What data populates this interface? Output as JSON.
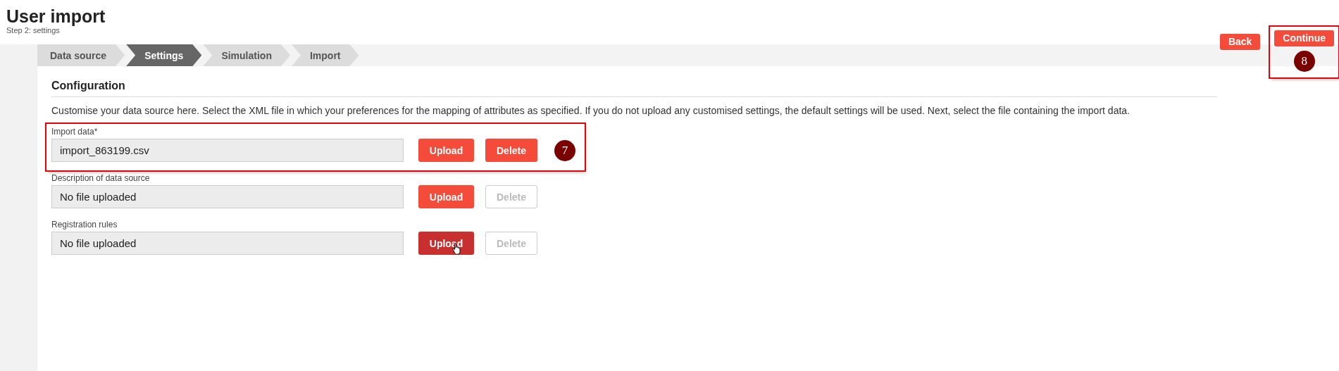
{
  "header": {
    "title": "User import",
    "subtitle": "Step 2: settings"
  },
  "steps": [
    {
      "label": "Data source",
      "selected": false
    },
    {
      "label": "Settings",
      "selected": true
    },
    {
      "label": "Simulation",
      "selected": false
    },
    {
      "label": "Import",
      "selected": false
    }
  ],
  "nav_buttons": [
    {
      "label": "Back"
    },
    {
      "label": "Continue",
      "callout": "8"
    }
  ],
  "section": {
    "title": "Configuration",
    "description": "Customise your data source here. Select the XML file in which your preferences for the mapping of attributes as specified. If you do not upload any customised settings, the default settings will be used. Next, select the file containing the import data."
  },
  "fields": [
    {
      "label": "Import data*",
      "value": "import_863199.csv",
      "callout": "7",
      "upload": {
        "label": "Upload",
        "hovered": false
      },
      "delete": {
        "label": "Delete",
        "disabled": false
      }
    },
    {
      "label": "Description of data source",
      "value": "No file uploaded",
      "upload": {
        "label": "Upload",
        "hovered": false
      },
      "delete": {
        "label": "Delete",
        "disabled": true
      }
    },
    {
      "label": "Registration rules",
      "value": "No file uploaded",
      "upload": {
        "label": "Upload",
        "hovered": true
      },
      "delete": {
        "label": "Delete",
        "disabled": true
      }
    }
  ]
}
